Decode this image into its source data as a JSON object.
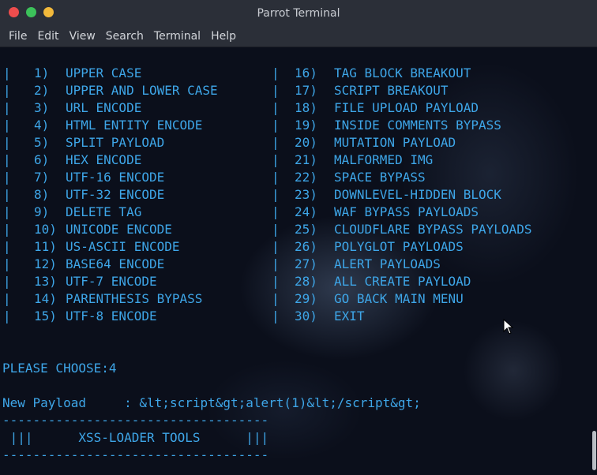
{
  "window": {
    "title": "Parrot Terminal"
  },
  "menu": [
    "File",
    "Edit",
    "View",
    "Search",
    "Terminal",
    "Help"
  ],
  "menu_left": [
    {
      "num": "1)",
      "label": "UPPER CASE"
    },
    {
      "num": "2)",
      "label": "UPPER AND LOWER CASE"
    },
    {
      "num": "3)",
      "label": "URL ENCODE"
    },
    {
      "num": "4)",
      "label": "HTML ENTITY ENCODE"
    },
    {
      "num": "5)",
      "label": "SPLIT PAYLOAD"
    },
    {
      "num": "6)",
      "label": "HEX ENCODE"
    },
    {
      "num": "7)",
      "label": "UTF-16 ENCODE"
    },
    {
      "num": "8)",
      "label": "UTF-32 ENCODE"
    },
    {
      "num": "9)",
      "label": "DELETE TAG"
    },
    {
      "num": "10)",
      "label": "UNICODE ENCODE"
    },
    {
      "num": "11)",
      "label": "US-ASCII ENCODE"
    },
    {
      "num": "12)",
      "label": "BASE64 ENCODE"
    },
    {
      "num": "13)",
      "label": "UTF-7 ENCODE"
    },
    {
      "num": "14)",
      "label": "PARENTHESIS BYPASS"
    },
    {
      "num": "15)",
      "label": "UTF-8 ENCODE"
    }
  ],
  "menu_right": [
    {
      "num": "16)",
      "label": "TAG BLOCK BREAKOUT"
    },
    {
      "num": "17)",
      "label": "SCRIPT BREAKOUT"
    },
    {
      "num": "18)",
      "label": "FILE UPLOAD PAYLOAD"
    },
    {
      "num": "19)",
      "label": "INSIDE COMMENTS BYPASS"
    },
    {
      "num": "20)",
      "label": "MUTATION PAYLOAD"
    },
    {
      "num": "21)",
      "label": "MALFORMED IMG"
    },
    {
      "num": "22)",
      "label": "SPACE BYPASS"
    },
    {
      "num": "23)",
      "label": "DOWNLEVEL-HIDDEN BLOCK"
    },
    {
      "num": "24)",
      "label": "WAF BYPASS PAYLOADS"
    },
    {
      "num": "25)",
      "label": "CLOUDFLARE BYPASS PAYLOADS"
    },
    {
      "num": "26)",
      "label": "POLYGLOT PAYLOADS"
    },
    {
      "num": "27)",
      "label": "ALERT PAYLOADS"
    },
    {
      "num": "28)",
      "label": "ALL CREATE PAYLOAD"
    },
    {
      "num": "29)",
      "label": "GO BACK MAIN MENU"
    },
    {
      "num": "30)",
      "label": "EXIT"
    }
  ],
  "separator": "|",
  "prompt": {
    "text": "PLEASE CHOOSE:4"
  },
  "payload": {
    "label": "New Payload     :",
    "value": "&lt;script&gt;alert(1)&lt;/script&gt;"
  },
  "banner": {
    "dashes": "-----------------------------------",
    "left": "|||",
    "title": "XSS-LOADER TOOLS",
    "right": "|||"
  },
  "colors": {
    "text": "#3ea6e8",
    "titlebar": "#2b2f38",
    "background": "#0b0f1b"
  }
}
